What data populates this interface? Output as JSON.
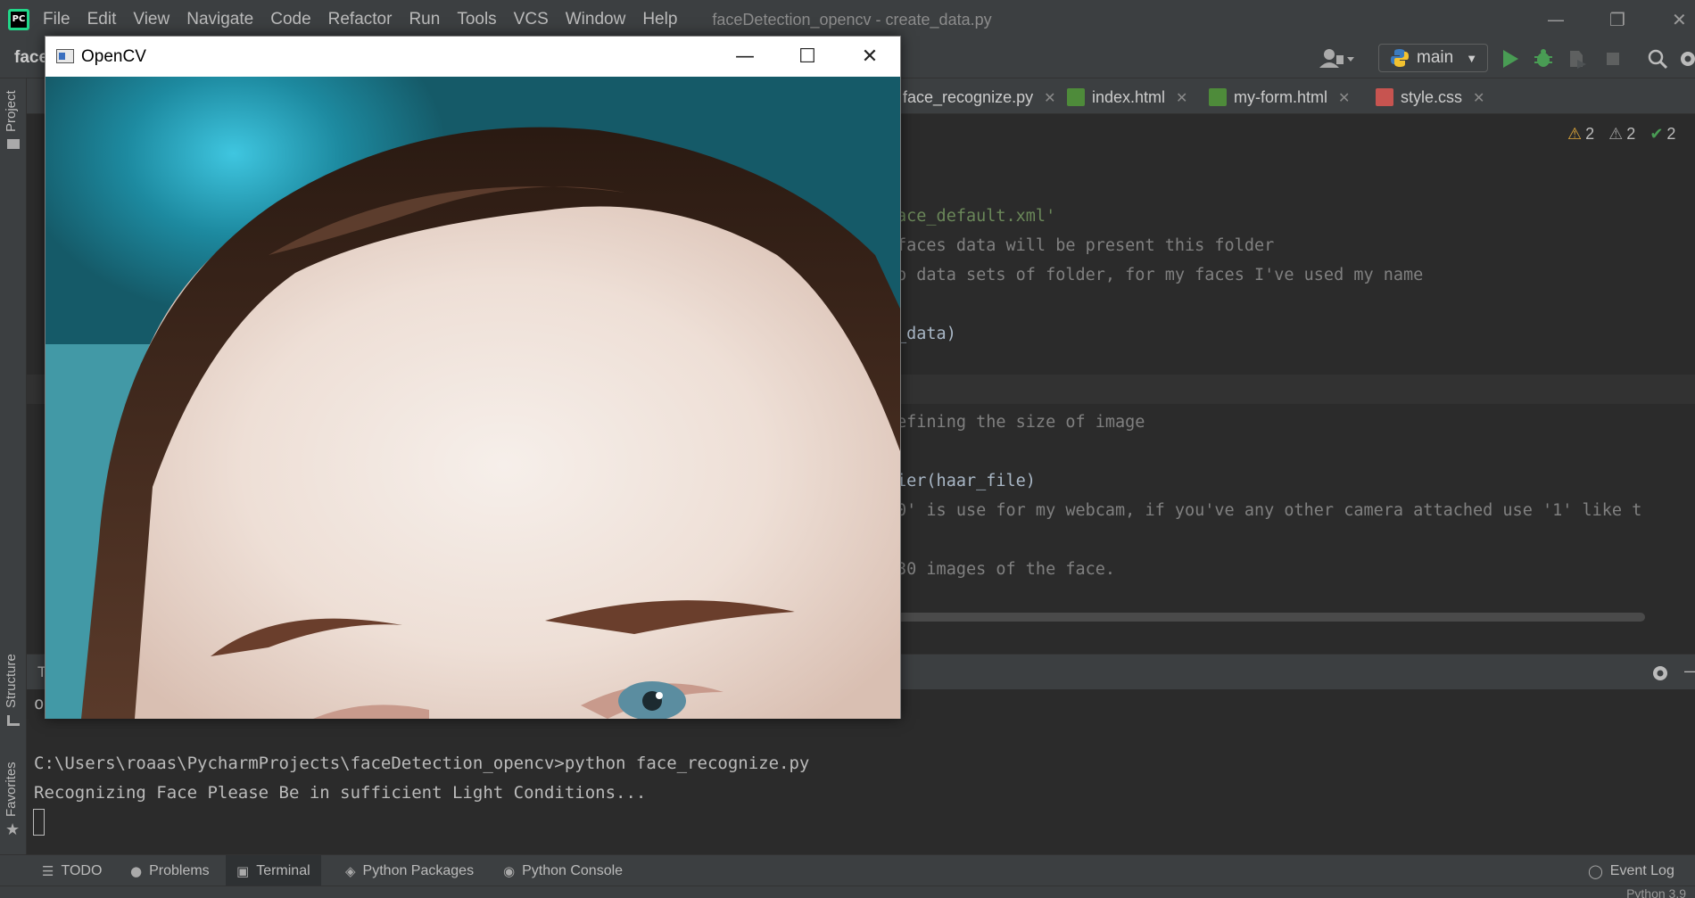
{
  "menubar": {
    "logo_text": "PC",
    "items": [
      "File",
      "Edit",
      "View",
      "Navigate",
      "Code",
      "Refactor",
      "Run",
      "Tools",
      "VCS",
      "Window",
      "Help"
    ],
    "window_title": "faceDetection_opencv - create_data.py"
  },
  "navbar": {
    "crumb": "face",
    "branch": "main"
  },
  "left_strip": {
    "project": "Project",
    "structure": "Structure",
    "favorites": "Favorites"
  },
  "tabs": [
    {
      "label": "face_recognize.py",
      "icon": "python-file-icon"
    },
    {
      "label": "index.html",
      "icon": "html-file-icon"
    },
    {
      "label": "my-form.html",
      "icon": "html-file-icon"
    },
    {
      "label": "style.css",
      "icon": "css-file-icon"
    }
  ],
  "inspections": {
    "warnings_a": "2",
    "warnings_b": "2",
    "ok": "2"
  },
  "code": [
    {
      "text": "ace_default.xml'",
      "kind": "string"
    },
    {
      "text": "faces data will be present this folder",
      "kind": "comment"
    },
    {
      "text": "o data sets of folder, for my faces I've used my name",
      "kind": "comment"
    },
    {
      "text": "_data)",
      "kind": "code"
    },
    {
      "text": "efining the size of image",
      "kind": "comment"
    },
    {
      "text": "ier(haar_file)",
      "kind": "code"
    },
    {
      "text": "0' is use for my webcam, if you've any other camera attached use '1' like t",
      "kind": "comment"
    },
    {
      "text": "30 images of the face.",
      "kind": "comment"
    }
  ],
  "terminal": {
    "header_label": "T",
    "partial": "o",
    "lines": [
      "C:\\Users\\roaas\\PycharmProjects\\faceDetection_opencv>python face_recognize.py",
      "Recognizing Face Please Be in sufficient Light Conditions..."
    ]
  },
  "bottom_tabs": [
    {
      "label": "TODO",
      "glyph": "☰",
      "icon": "list-icon"
    },
    {
      "label": "Problems",
      "glyph": "●",
      "icon": "problems-icon"
    },
    {
      "label": "Terminal",
      "glyph": "▣",
      "icon": "terminal-icon"
    },
    {
      "label": "Python Packages",
      "glyph": "◈",
      "icon": "packages-icon"
    },
    {
      "label": "Python Console",
      "glyph": "◉",
      "icon": "python-console-icon"
    }
  ],
  "event_log": "Event Log",
  "status": "Python 3.9",
  "cv_window": {
    "title": "OpenCV",
    "minimize": "—",
    "maximize": "☐",
    "close": "✕"
  },
  "colors": {
    "ide_bg": "#2b2b2b",
    "panel_bg": "#3c3f41",
    "comment": "#808080",
    "string": "#6a8759",
    "accent_green": "#499c54",
    "warning": "#e0a83a"
  }
}
